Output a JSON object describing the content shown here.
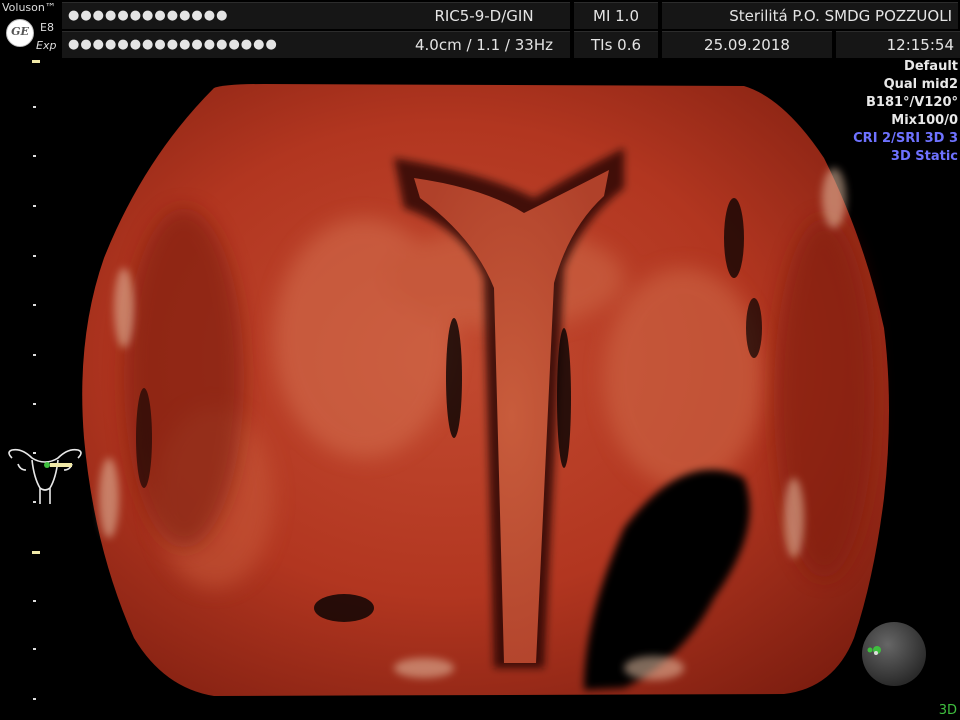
{
  "header": {
    "brand": "Voluson™",
    "logo_text": "GE",
    "model": "E8",
    "mode": "Exp",
    "patient_name_masked": "●●●●●●●●●●●●●",
    "patient_id_masked": "●●●●●●●●●●●●●●●●●",
    "probe": "RIC5-9-D/GIN",
    "depth_settings": "4.0cm / 1.1 / 33Hz",
    "mi": "MI  1.0",
    "tis": "TIs  0.6",
    "institution": "Sterilitá  P.O.  SMDG POZZUOLI",
    "date": "25.09.2018",
    "time": "12:15:54"
  },
  "info_panel": {
    "preset": "Default",
    "quality": "Qual mid2",
    "angles": "B181°/V120°",
    "mix": "Mix100/0",
    "cri_sri": "CRI 2/SRI 3D 3",
    "mode_3d": "3D Static"
  },
  "corner_label": "3D",
  "icons": {
    "uterus": "uterus-icon",
    "orientation": "orientation-sphere-icon",
    "logo": "ge-logo-icon"
  },
  "colors": {
    "tissue": "#b83a26",
    "tissue_dark": "#8e2214",
    "info_blue": "#6e72ff",
    "ruler_major": "#f1e9a8"
  }
}
